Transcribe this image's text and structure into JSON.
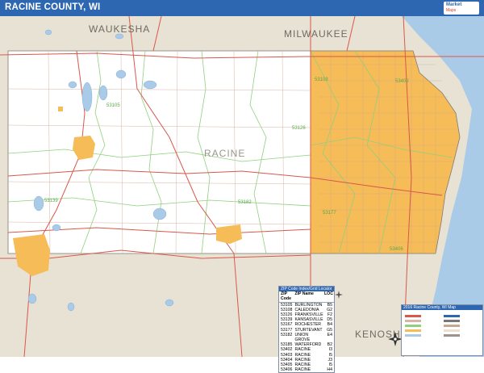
{
  "title": "RACINE COUNTY, WI",
  "logo": {
    "line1": "Market",
    "line2": "Maps"
  },
  "map_labels": {
    "waukesha": "WAUKESHA",
    "milwaukee": "MILWAUKEE",
    "racine": "RACINE",
    "kenosha": "KENOSHA"
  },
  "zip_labels": [
    "53126",
    "53108",
    "53105",
    "53182",
    "53139",
    "53402",
    "53177",
    "53406"
  ],
  "zip_table": {
    "header": "ZIP Code Index/Grid Locator",
    "columns": [
      "ZIP Code",
      "ZIP Name",
      "LOC"
    ],
    "rows": [
      [
        "53105",
        "BURLINGTON",
        "B5"
      ],
      [
        "53108",
        "CALEDONIA",
        "G2"
      ],
      [
        "53126",
        "FRANKSVILLE",
        "F2"
      ],
      [
        "53139",
        "KANSASVILLE",
        "D5"
      ],
      [
        "53167",
        "ROCHESTER",
        "B4"
      ],
      [
        "53177",
        "STURTEVANT",
        "G5"
      ],
      [
        "53182",
        "UNION GROVE",
        "E4"
      ],
      [
        "53185",
        "WATERFORD",
        "B2"
      ],
      [
        "53402",
        "RACINE",
        "I3"
      ],
      [
        "53403",
        "RACINE",
        "I5"
      ],
      [
        "53404",
        "RACINE",
        "J3"
      ],
      [
        "53405",
        "RACINE",
        "I5"
      ],
      [
        "53406",
        "RACINE",
        "H4"
      ]
    ]
  },
  "legend": {
    "header": "2016 Racine County, WI Map"
  },
  "colors": {
    "title_bar": "#2e67b1",
    "county_bg": "#ffffff",
    "neighbor_bg": "#e8e2d4",
    "urban_fill": "#f6bc58",
    "water": "#aacbe8",
    "zip_boundary": "#8fd07e",
    "major_road": "#d8584a",
    "minor_road": "#d8b3a7"
  }
}
